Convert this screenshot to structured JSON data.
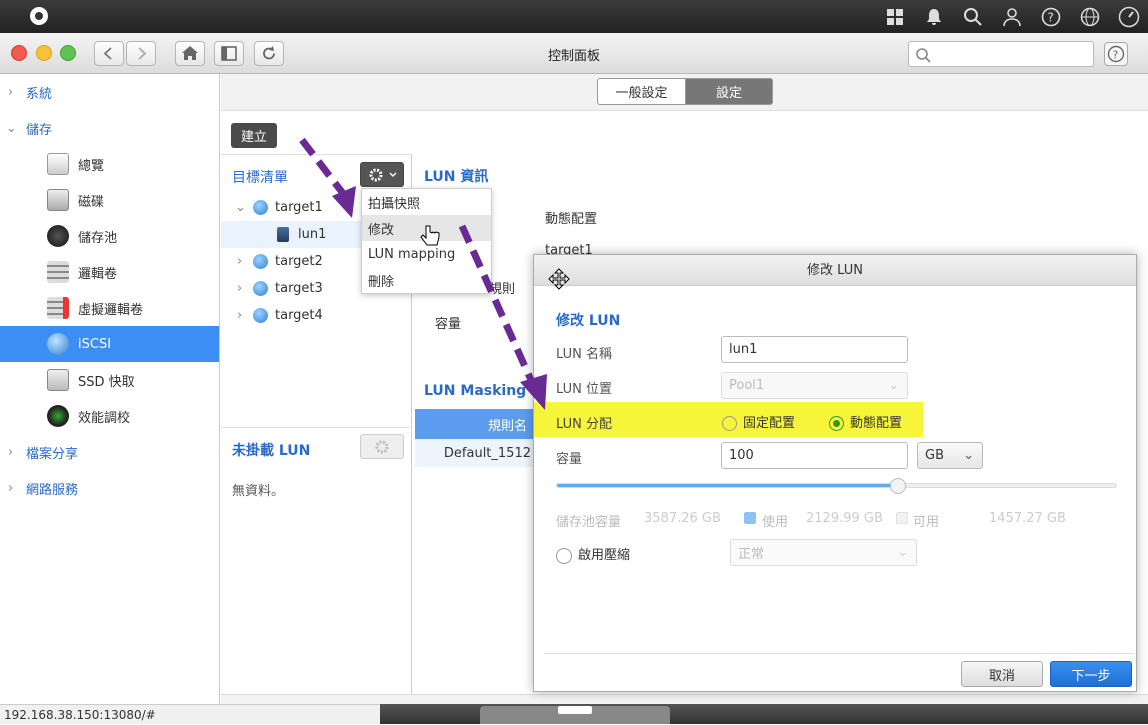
{
  "window": {
    "title": "控制面板",
    "search_placeholder": ""
  },
  "sidebar": {
    "items": [
      {
        "label": "系統",
        "type": "group"
      },
      {
        "label": "儲存",
        "type": "group"
      },
      {
        "label": "總覽",
        "type": "item"
      },
      {
        "label": "磁碟",
        "type": "item"
      },
      {
        "label": "儲存池",
        "type": "item"
      },
      {
        "label": "邏輯卷",
        "type": "item"
      },
      {
        "label": "虛擬邏輯卷",
        "type": "item"
      },
      {
        "label": "iSCSI",
        "type": "item",
        "selected": true
      },
      {
        "label": "SSD 快取",
        "type": "item"
      },
      {
        "label": "效能調校",
        "type": "item"
      },
      {
        "label": "檔案分享",
        "type": "group"
      },
      {
        "label": "網路服務",
        "type": "group"
      }
    ]
  },
  "tabs": {
    "general": "一般設定",
    "settings": "設定"
  },
  "toolbar": {
    "create": "建立"
  },
  "targets": {
    "title": "目標清單",
    "items": [
      "target1",
      "lun1",
      "target2",
      "target3",
      "target4"
    ]
  },
  "context_menu": [
    "拍攝快照",
    "修改",
    "LUN mapping",
    "刪除"
  ],
  "unmounted": {
    "title": "未掛載 LUN",
    "empty": "無資料。"
  },
  "lun_info": {
    "title": "LUN 資訊",
    "value1": "動態配置",
    "value2": "target1",
    "rule_label": "規則",
    "capacity_label": "容量"
  },
  "masking": {
    "title": "LUN Masking",
    "col": "規則名",
    "row": "Default_1512"
  },
  "modal": {
    "title": "修改 LUN",
    "section": "修改 LUN",
    "name_label": "LUN 名稱",
    "name_value": "lun1",
    "location_label": "LUN 位置",
    "location_value": "Pool1",
    "alloc_label": "LUN 分配",
    "opt_fixed": "固定配置",
    "opt_dynamic": "動態配置",
    "cap_label": "容量",
    "cap_value": "100",
    "cap_unit": "GB",
    "slider_level": 0.61,
    "pool_label": "儲存池容量",
    "pool_total": "3587.26 GB",
    "used_label": "使用",
    "used_value": "2129.99 GB",
    "avail_label": "可用",
    "avail_value": "1457.27 GB",
    "compress_label": "啟用壓縮",
    "compress_value": "正常",
    "cancel": "取消",
    "next": "下一步"
  },
  "status_url": "192.168.38.150:13080/#",
  "colors": {
    "accent": "#3c8ef4",
    "link": "#2a6ac8",
    "highlight": "#f7f53a",
    "arrow": "#6a2a93"
  }
}
